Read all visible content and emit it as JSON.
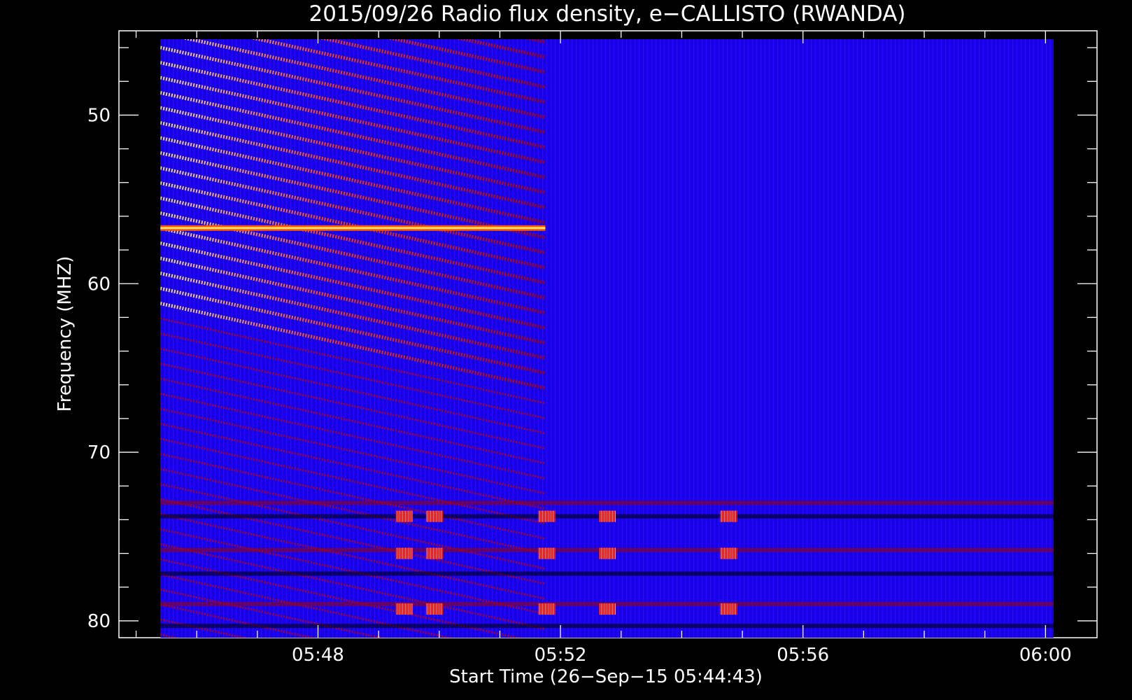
{
  "chart_data": {
    "type": "heatmap",
    "title": "2015/09/26  Radio flux density, e−CALLISTO (RWANDA)",
    "xlabel": "Start Time (26−Sep−15 05:44:43)",
    "ylabel": "Frequency (MHZ)",
    "x_ticks": [
      "05:48",
      "05:52",
      "05:56",
      "06:00"
    ],
    "y_ticks": [
      50,
      60,
      70,
      80
    ],
    "xlim": [
      "05:44:43",
      "06:00:51"
    ],
    "ylim": [
      45,
      81
    ],
    "data_time_range": [
      "05:45:24",
      "06:00:08"
    ],
    "data_freq_range": [
      45.5,
      81
    ],
    "colorscale": [
      "#000000",
      "#1500ff",
      "#cc0000",
      "#ff6600",
      "#ffee88"
    ],
    "features": [
      {
        "label": "diagonal interference stripes",
        "time_range": [
          "05:45:24",
          "05:51:45"
        ],
        "freq_range": [
          45.5,
          81
        ]
      },
      {
        "label": "strong narrowband line",
        "time_range": [
          "05:45:24",
          "05:51:45"
        ],
        "freq": 56.7
      },
      {
        "label": "bright bursts",
        "times": [
          "05:49:24",
          "05:49:54",
          "05:51:45",
          "05:52:45",
          "05:54:45"
        ],
        "freqs": [
          73.8,
          76,
          79.3
        ]
      }
    ],
    "grid": false,
    "legend": "none"
  }
}
